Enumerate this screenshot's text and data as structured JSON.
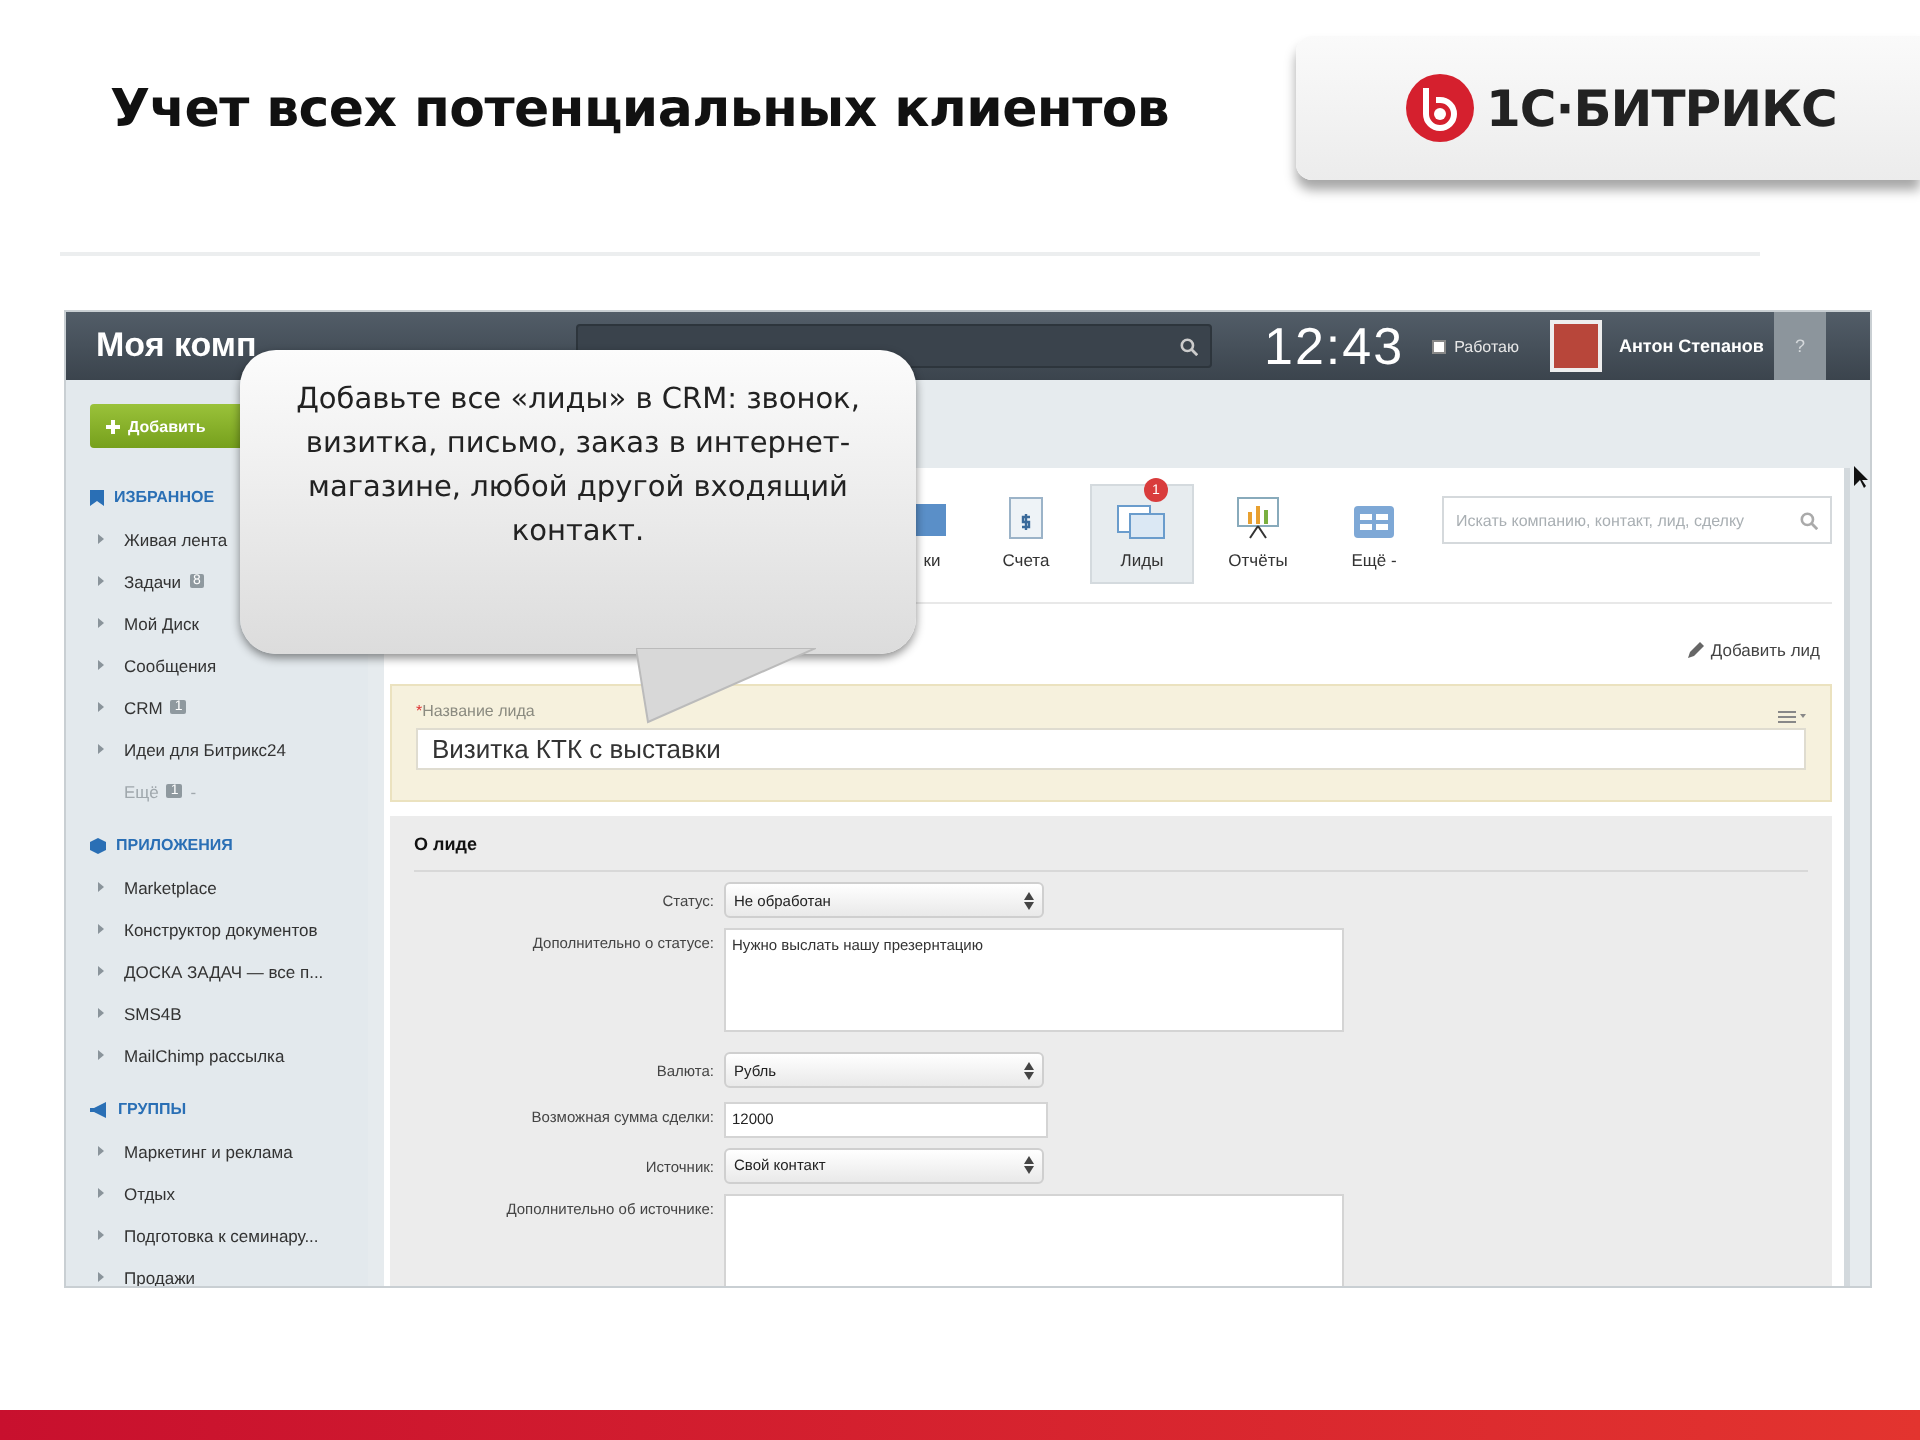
{
  "slide": {
    "title": "Учет всех потенциальных клиентов",
    "logo_text": "1С·БИТРИКС"
  },
  "callout": {
    "text": "Добавьте все «лиды» в CRM: звонок, визитка, письмо, заказ в интернет-магазине,  любой другой входящий контакт."
  },
  "app": {
    "header": {
      "company": "Моя комп",
      "clock": "12:43",
      "status": "Работаю",
      "user": "Антон Степанов",
      "help": "?"
    },
    "add_button": "Добавить",
    "sidebar": [
      {
        "kind": "section",
        "label": "ИЗБРАННОЕ"
      },
      {
        "kind": "item",
        "label": "Живая лента"
      },
      {
        "kind": "item",
        "label": "Задачи",
        "badge": "8"
      },
      {
        "kind": "item",
        "label": "Мой Диск"
      },
      {
        "kind": "item",
        "label": "Сообщения"
      },
      {
        "kind": "item",
        "label": "CRM",
        "badge": "1"
      },
      {
        "kind": "item",
        "label": "Идеи для Битрикс24"
      },
      {
        "kind": "more",
        "label": "Ещё",
        "badge": "1",
        "caret": "-"
      },
      {
        "kind": "section",
        "label": "ПРИЛОЖЕНИЯ"
      },
      {
        "kind": "item",
        "label": "Marketplace"
      },
      {
        "kind": "item",
        "label": "Конструктор документов"
      },
      {
        "kind": "item",
        "label": "ДОСКА ЗАДАЧ — все п..."
      },
      {
        "kind": "item",
        "label": "SMS4B"
      },
      {
        "kind": "item",
        "label": "MailChimp рассылка"
      },
      {
        "kind": "section",
        "label": "ГРУППЫ"
      },
      {
        "kind": "item",
        "label": "Маркетинг и реклама"
      },
      {
        "kind": "item",
        "label": "Отдых"
      },
      {
        "kind": "item",
        "label": "Подготовка к семинару..."
      },
      {
        "kind": "item",
        "label": "Продажи"
      }
    ],
    "toolbar": [
      {
        "label": "ки",
        "selected": false
      },
      {
        "label": "Счета",
        "selected": false
      },
      {
        "label": "Лиды",
        "selected": true,
        "badge": "1"
      },
      {
        "label": "Отчёты",
        "selected": false
      },
      {
        "label": "Ещё -",
        "selected": false
      }
    ],
    "search": {
      "placeholder": "Искать компанию, контакт, лид, сделку"
    },
    "add_lead": "Добавить лид",
    "lead_name": {
      "required_mark": "*",
      "label": "Название лида",
      "value": "Визитка КТК с выставки"
    },
    "section": {
      "title": "О лиде",
      "fields": [
        {
          "kind": "select",
          "label": "Статус:",
          "value": "Не обработан"
        },
        {
          "kind": "textarea",
          "label": "Дополнительно о статусе:",
          "value": "Нужно выслать нашу презернтацию"
        },
        {
          "kind": "select",
          "label": "Валюта:",
          "value": "Рубль"
        },
        {
          "kind": "text",
          "label": "Возможная сумма сделки:",
          "value": "12000"
        },
        {
          "kind": "select",
          "label": "Источник:",
          "value": "Свой контакт"
        },
        {
          "kind": "textarea",
          "label": "Дополнительно об источнике:"
        }
      ]
    }
  }
}
